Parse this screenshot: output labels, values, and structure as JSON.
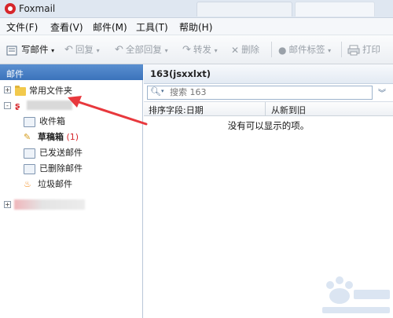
{
  "window": {
    "title": "Foxmail"
  },
  "menu": [
    "文件(F)",
    "查看(V)",
    "邮件(M)",
    "工具(T)",
    "帮助(H)"
  ],
  "toolbar": {
    "compose": "写邮件",
    "reply": "回复",
    "reply_all": "全部回复",
    "forward": "转发",
    "delete": "删除",
    "tags": "邮件标签",
    "print": "打印"
  },
  "left": {
    "header": "邮件",
    "common_folders": "常用文件夹",
    "folders": [
      {
        "label": "收件箱",
        "count": ""
      },
      {
        "label": "草稿箱",
        "count": "(1)"
      },
      {
        "label": "已发送邮件",
        "count": ""
      },
      {
        "label": "已删除邮件",
        "count": ""
      },
      {
        "label": "垃圾邮件",
        "count": ""
      }
    ],
    "expander_plus": "+",
    "expander_minus": "-"
  },
  "right": {
    "account_title": "163(jsxxlxt)",
    "search_placeholder": "搜索 163",
    "sort_field": "排序字段:日期",
    "sort_order": "从新到旧",
    "empty": "没有可以显示的项。"
  },
  "colors": {
    "accent_red": "#d6262b",
    "arrow_red": "#e8383d",
    "header_blue": "#3b73bb"
  }
}
